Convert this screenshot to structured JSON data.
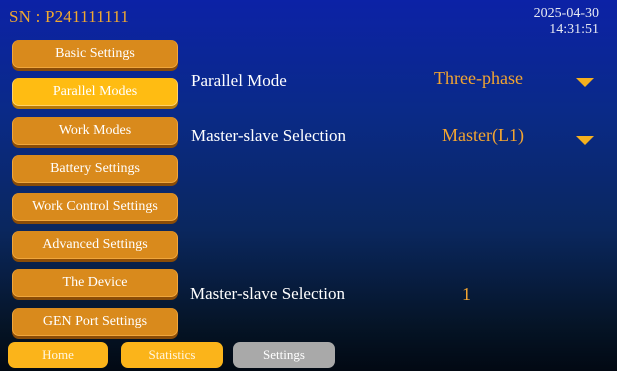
{
  "header": {
    "serial_number": "SN : P241111111",
    "date": "2025-04-30",
    "time": "14:31:51"
  },
  "sidebar": {
    "items": [
      {
        "label": "Basic Settings",
        "active": false
      },
      {
        "label": "Parallel Modes",
        "active": true
      },
      {
        "label": "Work Modes",
        "active": false
      },
      {
        "label": "Battery Settings",
        "active": false
      },
      {
        "label": "Work Control Settings",
        "active": false
      },
      {
        "label": "Advanced Settings",
        "active": false
      },
      {
        "label": "The Device",
        "active": false
      },
      {
        "label": "GEN Port Settings",
        "active": false
      }
    ]
  },
  "main": {
    "parallel_mode": {
      "label": "Parallel Mode",
      "value": "Three-phase"
    },
    "master_slave": {
      "label": "Master-slave Selection",
      "value": "Master(L1)"
    },
    "master_slave_number": {
      "label": "Master-slave Selection",
      "value": "1"
    }
  },
  "footer": {
    "tabs": [
      {
        "label": "Home",
        "active": false
      },
      {
        "label": "Statistics",
        "active": false
      },
      {
        "label": "Settings",
        "active": true
      }
    ]
  },
  "colors": {
    "accent_orange": "#d98a1c",
    "active_yellow": "#ffbc12",
    "value_orange": "#f3a531",
    "selected_tab_gray": "#a9a9a9",
    "background_top": "#0c22a6",
    "background_bottom": "#020913"
  },
  "icons": {
    "dropdown": "caret-down-icon"
  }
}
